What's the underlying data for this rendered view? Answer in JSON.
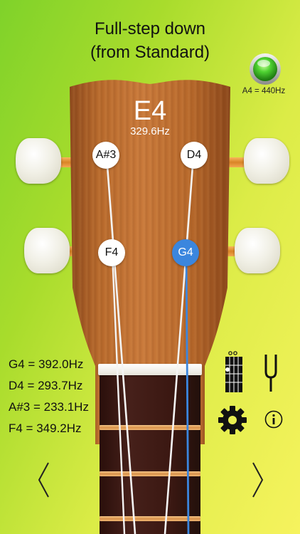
{
  "header": {
    "title_line1": "Full-step down",
    "title_line2": "(from Standard)",
    "reference_pitch": "A4 = 440Hz"
  },
  "tuner": {
    "detected_note": "E4",
    "detected_frequency": "329.6Hz",
    "active_string": "G4"
  },
  "strings": {
    "top_left": "A#3",
    "top_right": "D4",
    "bottom_left": "F4",
    "bottom_right": "G4"
  },
  "frequencies": [
    "G4 = 392.0Hz",
    "D4 = 293.7Hz",
    "A#3 = 233.1Hz",
    "F4 = 349.2Hz"
  ],
  "icons": {
    "status_led": "green-led-icon",
    "chord_chart": "chord-chart-icon",
    "tuning_fork": "tuning-fork-icon",
    "settings": "gear-icon",
    "info": "info-icon",
    "prev": "chevron-left-icon",
    "next": "chevron-right-icon"
  },
  "colors": {
    "active_string": "#3b86de",
    "led_green": "#3fbf2a"
  }
}
